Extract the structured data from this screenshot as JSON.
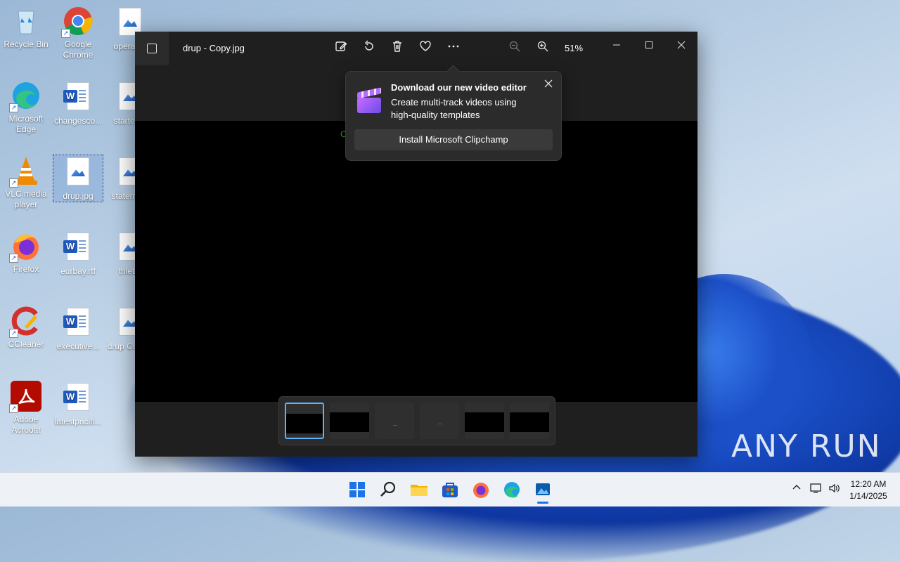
{
  "desktop": {
    "icons": [
      {
        "label": "Recycle Bin"
      },
      {
        "label": "Google Chrome"
      },
      {
        "label": "operati..."
      },
      {
        "label": "Microsoft Edge"
      },
      {
        "label": "changesco..."
      },
      {
        "label": "started..."
      },
      {
        "label": "VLC media player"
      },
      {
        "label": "drup.jpg"
      },
      {
        "label": "stateme..."
      },
      {
        "label": "Firefox"
      },
      {
        "label": "eurbay.rtf"
      },
      {
        "label": "thlet..."
      },
      {
        "label": "CCleaner"
      },
      {
        "label": "executive..."
      },
      {
        "label": "drup Copy..."
      },
      {
        "label": "Adobe Acrobat"
      },
      {
        "label": "latestpacifi..."
      }
    ]
  },
  "photos": {
    "title": "drup - Copy.jpg",
    "zoom": "51%",
    "toolbar_icons": [
      "edit-icon",
      "rotate-icon",
      "delete-icon",
      "favorite-icon",
      "more-icon",
      "zoom-out-icon",
      "zoom-in-icon"
    ],
    "popup": {
      "title": "Download our new video editor",
      "body": "Create multi-track videos using high-quality templates",
      "button": "Install Microsoft Clipchamp"
    },
    "stray_text": "C",
    "thumbnails": [
      {
        "active": true
      },
      {
        "active": false
      },
      {
        "active": false
      },
      {
        "active": false
      },
      {
        "active": false
      },
      {
        "active": false
      }
    ]
  },
  "taskbar": {
    "time": "12:20 AM",
    "date": "1/14/2025"
  },
  "watermark": "ANY RUN"
}
